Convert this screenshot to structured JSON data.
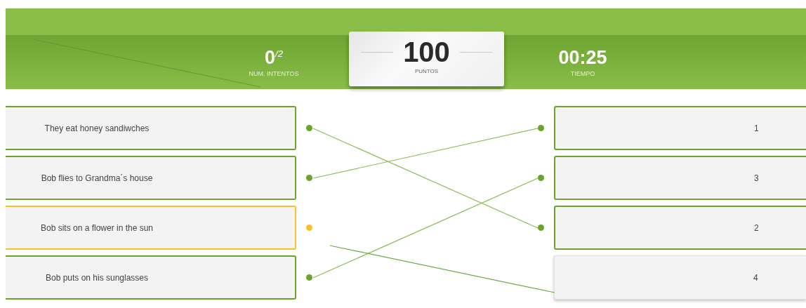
{
  "header": {
    "attempts": {
      "value": "0",
      "total": "/2",
      "label": "NUM. INTENTOS"
    },
    "score": {
      "value": "100",
      "label": "PUNTOS"
    },
    "time": {
      "value": "00:25",
      "label": "TIEMPO"
    }
  },
  "left_items": [
    {
      "text": "They eat honey sandiwches",
      "matched": true,
      "selected": false,
      "linked_to": [
        false,
        false,
        true,
        false
      ]
    },
    {
      "text": "Bob flies to Grandma´s house",
      "matched": true,
      "selected": false,
      "linked_to": [
        true,
        false,
        false,
        false
      ]
    },
    {
      "text": "Bob sits on a flower in the sun",
      "matched": false,
      "selected": true
    },
    {
      "text": "Bob puts on his sunglasses",
      "matched": true,
      "selected": false,
      "linked_to": [
        false,
        true,
        false,
        false
      ]
    }
  ],
  "right_items": [
    {
      "text": "1",
      "matched": true
    },
    {
      "text": "3",
      "matched": true
    },
    {
      "text": "2",
      "matched": true
    },
    {
      "text": "4",
      "matched": false
    }
  ]
}
